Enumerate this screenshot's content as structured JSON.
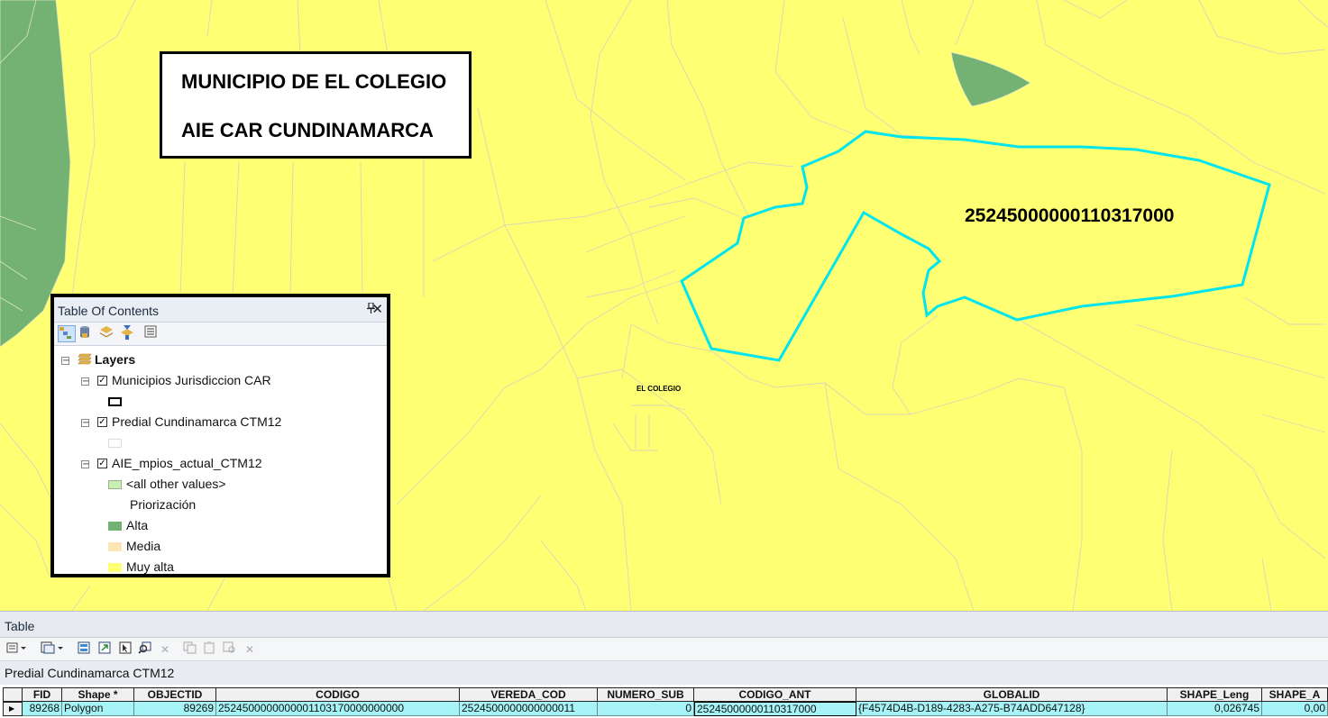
{
  "map": {
    "title_line1": "MUNICIPIO DE EL COLEGIO",
    "title_line2": "AIE CAR CUNDINAMARCA",
    "parcel_label": "25245000000110317000",
    "town_label": "EL COLEGIO",
    "colors": {
      "muy_alta": "#ffff73",
      "alta": "#73b273",
      "parcel_outline": "#00e5ee",
      "parcel_lines": "#dcdcc8"
    }
  },
  "toc": {
    "title": "Table Of Contents",
    "pin_icon": "pin-icon",
    "close_glyph": "✕",
    "toolbar_icons": [
      "list-by-drawing-order-icon",
      "list-by-source-icon",
      "list-by-visibility-icon",
      "list-by-selection-icon",
      "options-icon"
    ],
    "root": "Layers",
    "layers": [
      {
        "name": "Municipios Jurisdiccion CAR",
        "checked": true
      },
      {
        "name": "Predial Cundinamarca CTM12",
        "checked": true
      },
      {
        "name": "AIE_mpios_actual_CTM12",
        "checked": true
      }
    ],
    "legend": {
      "other_values": "<all other values>",
      "field_heading": "Priorización",
      "classes": [
        {
          "label": "Alta",
          "color": "#73b273"
        },
        {
          "label": "Media",
          "color": "#fde6b4"
        },
        {
          "label": "Muy alta",
          "color": "#ffff73"
        }
      ],
      "other_color": "#c8f0b4"
    }
  },
  "table": {
    "title": "Table",
    "layer_name": "Predial Cundinamarca CTM12",
    "toolbar_icons": [
      "table-options-icon",
      "related-tables-icon",
      "select-by-attributes-icon",
      "switch-selection-icon",
      "clear-selection-icon",
      "zoom-to-selected-icon",
      "delete-selected-icon",
      "copy-icon",
      "paste-icon",
      "undo-icon",
      "delete-icon"
    ],
    "columns": [
      "FID",
      "Shape *",
      "OBJECTID",
      "CODIGO",
      "VEREDA_COD",
      "NUMERO_SUB",
      "CODIGO_ANT",
      "GLOBALID",
      "SHAPE_Leng",
      "SHAPE_A"
    ],
    "row": [
      "89268",
      "Polygon",
      "89269",
      "2524500000000001103170000000000",
      "2524500000000000011",
      "0",
      "25245000000110317000",
      "{F4574D4B-D189-4283-A275-B74ADD647128}",
      "0,026745",
      "0,00"
    ]
  }
}
